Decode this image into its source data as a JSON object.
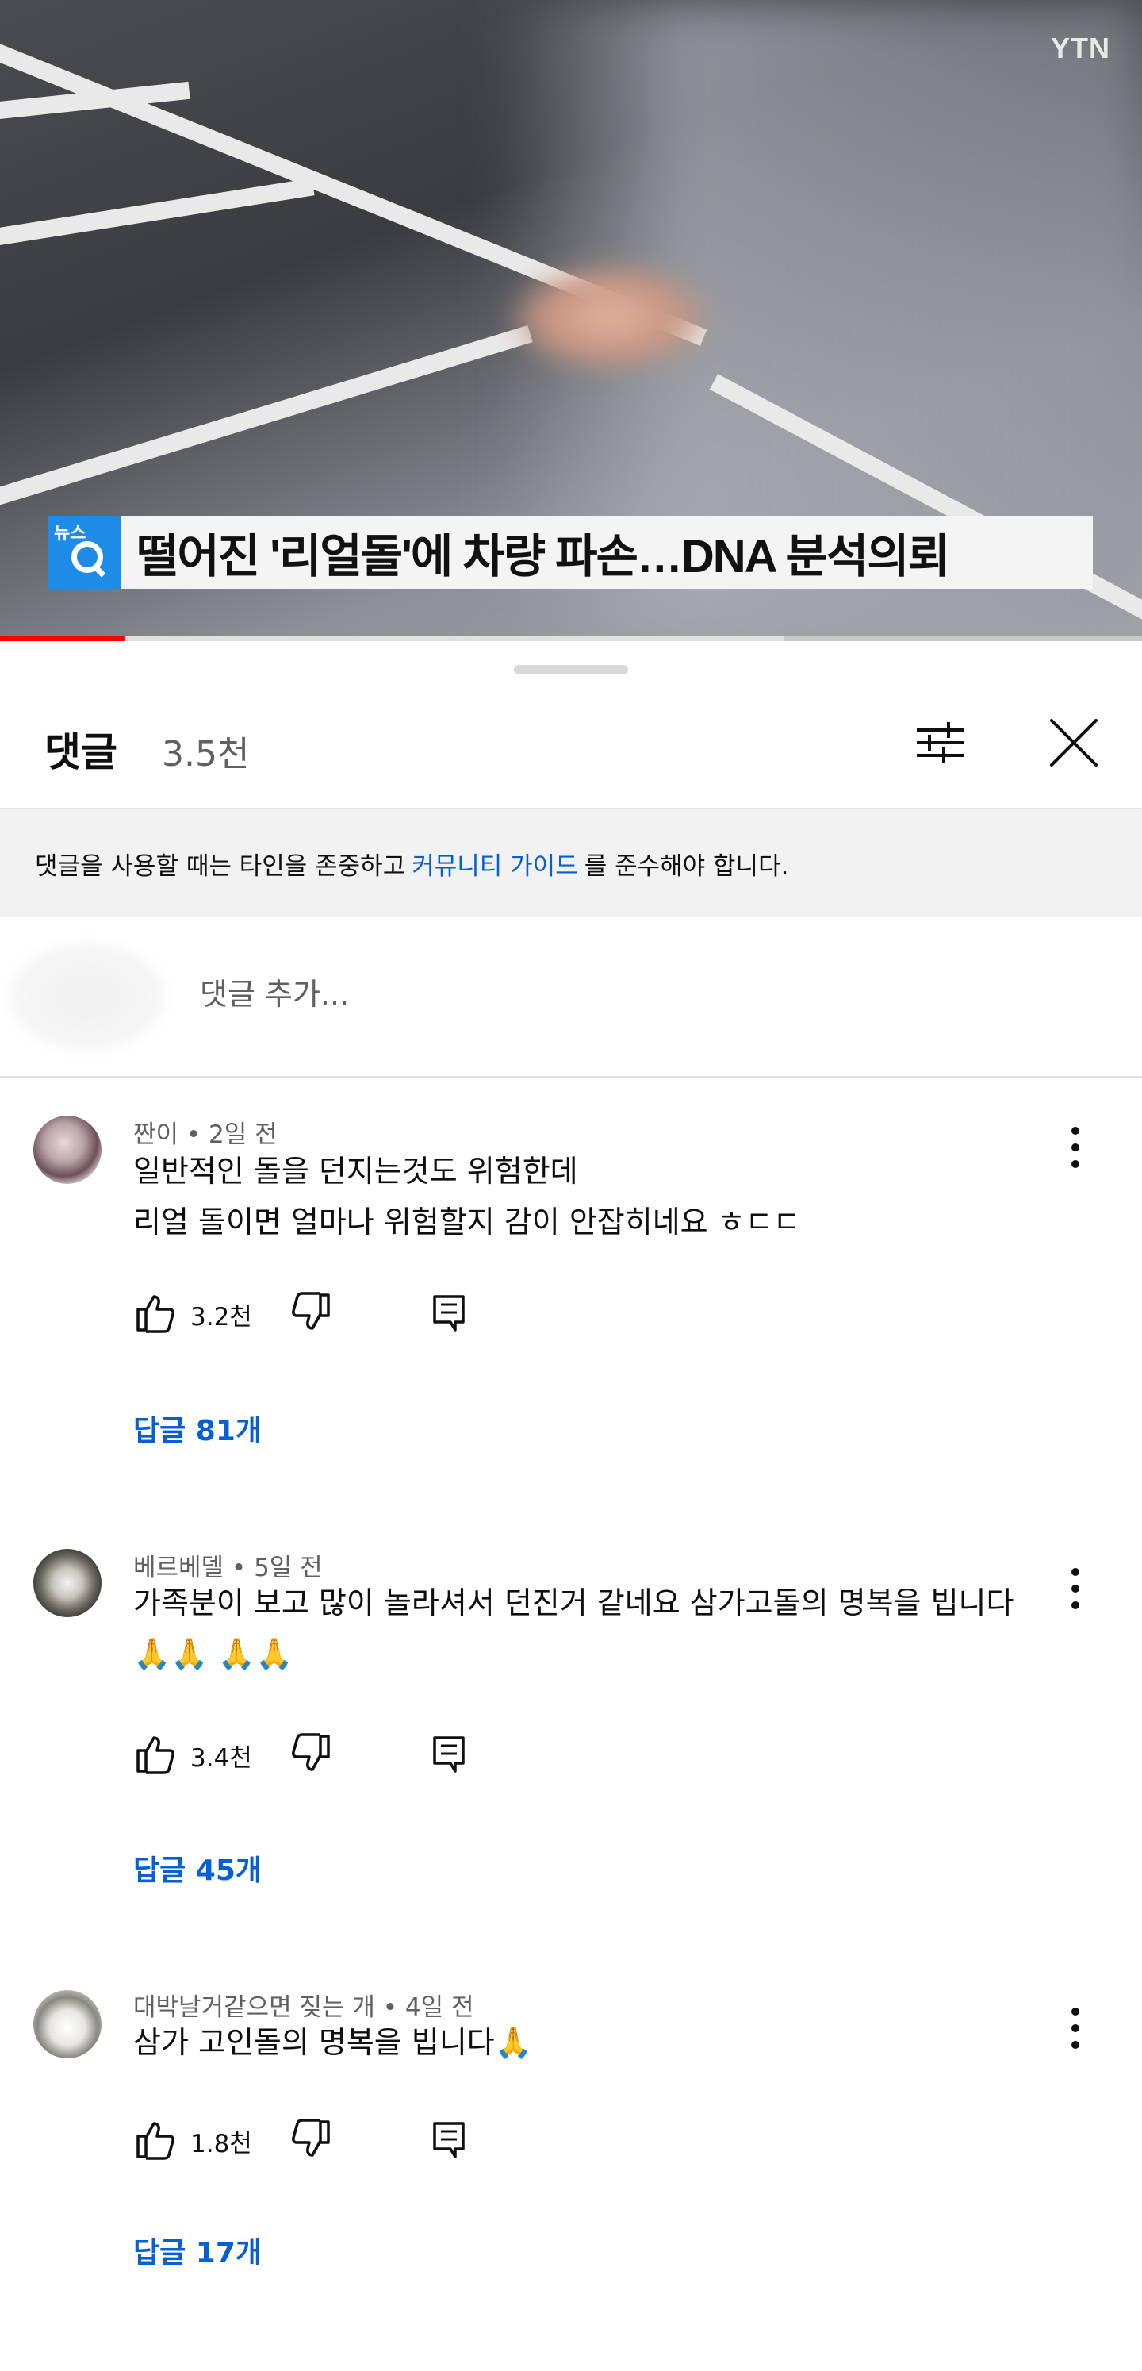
{
  "video": {
    "channel_logo": "YTN",
    "news_badge": "뉴스",
    "caption": "떨어진 '리얼돌'에 차량 파손…DNA 분석의뢰",
    "progress_fraction": 0.11
  },
  "comments_sheet": {
    "title": "댓글",
    "count": "3.5천",
    "guide_before": "댓글을 사용할 때는 타인을 존중하고",
    "guide_link": "커뮤니티 가이드",
    "guide_after": "를 준수해야 합니다.",
    "add_placeholder": "댓글 추가...",
    "icons": {
      "filter": "sliders-icon",
      "close": "close-icon"
    }
  },
  "comments": [
    {
      "meta": "짠이 • 2일 전",
      "text": "일반적인 돌을 던지는것도 위험한데\n리얼 돌이면 얼마나 위험할지 감이 안잡히네요 ㅎㄷㄷ",
      "likes": "3.2천",
      "replies": "답글 81개"
    },
    {
      "meta": "베르베델 • 5일 전",
      "text": "가족분이 보고 많이 놀라셔서 던진거 같네요 삼가고돌의 명복을 빕니다\n🙏🙏 🙏🙏",
      "likes": "3.4천",
      "replies": "답글 45개"
    },
    {
      "meta": "대박날거같으면 짖는 개 • 4일 전",
      "text": "삼가 고인돌의 명복을 빕니다🙏",
      "likes": "1.8천",
      "replies": "답글 17개"
    }
  ]
}
